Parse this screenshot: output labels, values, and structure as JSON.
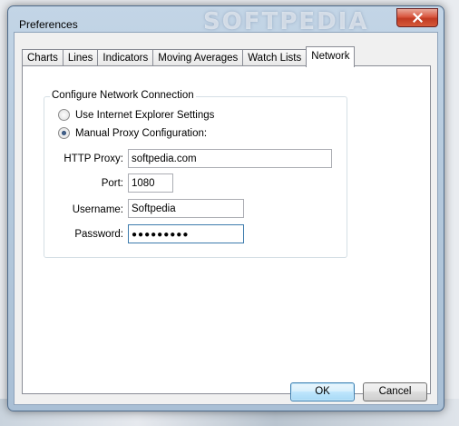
{
  "window": {
    "title": "Preferences",
    "watermark": "SOFTPEDIA"
  },
  "tabs": [
    {
      "label": "Charts",
      "active": false
    },
    {
      "label": "Lines",
      "active": false
    },
    {
      "label": "Indicators",
      "active": false
    },
    {
      "label": "Moving Averages",
      "active": false
    },
    {
      "label": "Watch Lists",
      "active": false
    },
    {
      "label": "Network",
      "active": true
    }
  ],
  "network": {
    "group_title": "Configure Network Connection",
    "options": [
      {
        "label": "Use Internet Explorer Settings",
        "selected": false
      },
      {
        "label": "Manual Proxy Configuration:",
        "selected": true
      }
    ],
    "fields": {
      "http_proxy": {
        "label": "HTTP Proxy:",
        "value": "softpedia.com"
      },
      "port": {
        "label": "Port:",
        "value": "1080"
      },
      "username": {
        "label": "Username:",
        "value": "Softpedia"
      },
      "password": {
        "label": "Password:",
        "value": "●●●●●●●●●"
      }
    }
  },
  "buttons": {
    "ok": "OK",
    "cancel": "Cancel"
  },
  "icons": {
    "close": "close-icon"
  }
}
